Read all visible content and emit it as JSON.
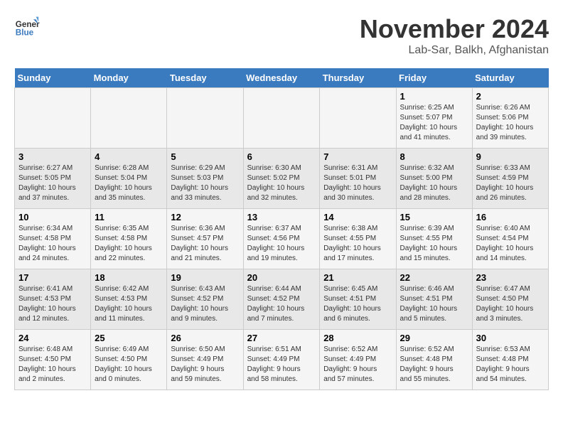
{
  "header": {
    "logo_line1": "General",
    "logo_line2": "Blue",
    "title": "November 2024",
    "subtitle": "Lab-Sar, Balkh, Afghanistan"
  },
  "weekdays": [
    "Sunday",
    "Monday",
    "Tuesday",
    "Wednesday",
    "Thursday",
    "Friday",
    "Saturday"
  ],
  "weeks": [
    [
      {
        "day": "",
        "detail": ""
      },
      {
        "day": "",
        "detail": ""
      },
      {
        "day": "",
        "detail": ""
      },
      {
        "day": "",
        "detail": ""
      },
      {
        "day": "",
        "detail": ""
      },
      {
        "day": "1",
        "detail": "Sunrise: 6:25 AM\nSunset: 5:07 PM\nDaylight: 10 hours\nand 41 minutes."
      },
      {
        "day": "2",
        "detail": "Sunrise: 6:26 AM\nSunset: 5:06 PM\nDaylight: 10 hours\nand 39 minutes."
      }
    ],
    [
      {
        "day": "3",
        "detail": "Sunrise: 6:27 AM\nSunset: 5:05 PM\nDaylight: 10 hours\nand 37 minutes."
      },
      {
        "day": "4",
        "detail": "Sunrise: 6:28 AM\nSunset: 5:04 PM\nDaylight: 10 hours\nand 35 minutes."
      },
      {
        "day": "5",
        "detail": "Sunrise: 6:29 AM\nSunset: 5:03 PM\nDaylight: 10 hours\nand 33 minutes."
      },
      {
        "day": "6",
        "detail": "Sunrise: 6:30 AM\nSunset: 5:02 PM\nDaylight: 10 hours\nand 32 minutes."
      },
      {
        "day": "7",
        "detail": "Sunrise: 6:31 AM\nSunset: 5:01 PM\nDaylight: 10 hours\nand 30 minutes."
      },
      {
        "day": "8",
        "detail": "Sunrise: 6:32 AM\nSunset: 5:00 PM\nDaylight: 10 hours\nand 28 minutes."
      },
      {
        "day": "9",
        "detail": "Sunrise: 6:33 AM\nSunset: 4:59 PM\nDaylight: 10 hours\nand 26 minutes."
      }
    ],
    [
      {
        "day": "10",
        "detail": "Sunrise: 6:34 AM\nSunset: 4:58 PM\nDaylight: 10 hours\nand 24 minutes."
      },
      {
        "day": "11",
        "detail": "Sunrise: 6:35 AM\nSunset: 4:58 PM\nDaylight: 10 hours\nand 22 minutes."
      },
      {
        "day": "12",
        "detail": "Sunrise: 6:36 AM\nSunset: 4:57 PM\nDaylight: 10 hours\nand 21 minutes."
      },
      {
        "day": "13",
        "detail": "Sunrise: 6:37 AM\nSunset: 4:56 PM\nDaylight: 10 hours\nand 19 minutes."
      },
      {
        "day": "14",
        "detail": "Sunrise: 6:38 AM\nSunset: 4:55 PM\nDaylight: 10 hours\nand 17 minutes."
      },
      {
        "day": "15",
        "detail": "Sunrise: 6:39 AM\nSunset: 4:55 PM\nDaylight: 10 hours\nand 15 minutes."
      },
      {
        "day": "16",
        "detail": "Sunrise: 6:40 AM\nSunset: 4:54 PM\nDaylight: 10 hours\nand 14 minutes."
      }
    ],
    [
      {
        "day": "17",
        "detail": "Sunrise: 6:41 AM\nSunset: 4:53 PM\nDaylight: 10 hours\nand 12 minutes."
      },
      {
        "day": "18",
        "detail": "Sunrise: 6:42 AM\nSunset: 4:53 PM\nDaylight: 10 hours\nand 11 minutes."
      },
      {
        "day": "19",
        "detail": "Sunrise: 6:43 AM\nSunset: 4:52 PM\nDaylight: 10 hours\nand 9 minutes."
      },
      {
        "day": "20",
        "detail": "Sunrise: 6:44 AM\nSunset: 4:52 PM\nDaylight: 10 hours\nand 7 minutes."
      },
      {
        "day": "21",
        "detail": "Sunrise: 6:45 AM\nSunset: 4:51 PM\nDaylight: 10 hours\nand 6 minutes."
      },
      {
        "day": "22",
        "detail": "Sunrise: 6:46 AM\nSunset: 4:51 PM\nDaylight: 10 hours\nand 5 minutes."
      },
      {
        "day": "23",
        "detail": "Sunrise: 6:47 AM\nSunset: 4:50 PM\nDaylight: 10 hours\nand 3 minutes."
      }
    ],
    [
      {
        "day": "24",
        "detail": "Sunrise: 6:48 AM\nSunset: 4:50 PM\nDaylight: 10 hours\nand 2 minutes."
      },
      {
        "day": "25",
        "detail": "Sunrise: 6:49 AM\nSunset: 4:50 PM\nDaylight: 10 hours\nand 0 minutes."
      },
      {
        "day": "26",
        "detail": "Sunrise: 6:50 AM\nSunset: 4:49 PM\nDaylight: 9 hours\nand 59 minutes."
      },
      {
        "day": "27",
        "detail": "Sunrise: 6:51 AM\nSunset: 4:49 PM\nDaylight: 9 hours\nand 58 minutes."
      },
      {
        "day": "28",
        "detail": "Sunrise: 6:52 AM\nSunset: 4:49 PM\nDaylight: 9 hours\nand 57 minutes."
      },
      {
        "day": "29",
        "detail": "Sunrise: 6:52 AM\nSunset: 4:48 PM\nDaylight: 9 hours\nand 55 minutes."
      },
      {
        "day": "30",
        "detail": "Sunrise: 6:53 AM\nSunset: 4:48 PM\nDaylight: 9 hours\nand 54 minutes."
      }
    ]
  ]
}
